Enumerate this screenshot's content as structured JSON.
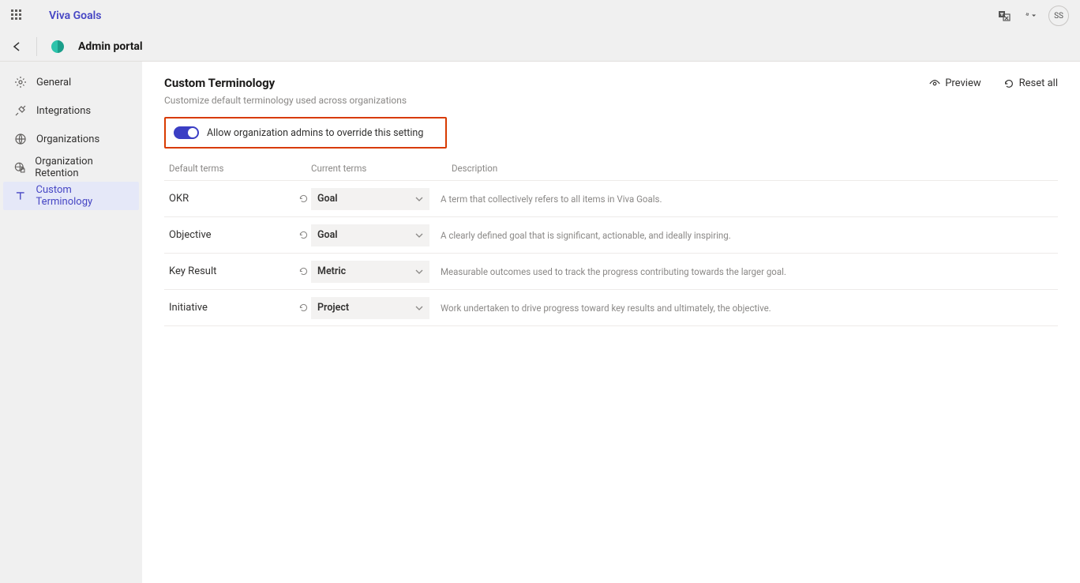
{
  "header": {
    "app_name": "Viva Goals",
    "avatar_initials": "SS"
  },
  "subheader": {
    "title": "Admin portal"
  },
  "sidebar": {
    "items": [
      {
        "label": "General"
      },
      {
        "label": "Integrations"
      },
      {
        "label": "Organizations"
      },
      {
        "label": "Organization Retention"
      },
      {
        "label": "Custom Terminology"
      }
    ]
  },
  "page": {
    "title": "Custom Terminology",
    "subtitle": "Customize default terminology used across organizations",
    "preview_label": "Preview",
    "reset_label": "Reset all",
    "toggle_label": "Allow organization admins to override this setting"
  },
  "columns": {
    "default": "Default terms",
    "current": "Current terms",
    "description": "Description"
  },
  "rows": [
    {
      "default": "OKR",
      "current": "Goal",
      "description": "A term that collectively refers to all items in Viva Goals."
    },
    {
      "default": "Objective",
      "current": "Goal",
      "description": "A clearly defined goal that is significant, actionable, and ideally inspiring."
    },
    {
      "default": "Key Result",
      "current": "Metric",
      "description": "Measurable outcomes used to track the progress contributing towards the larger goal."
    },
    {
      "default": "Initiative",
      "current": "Project",
      "description": "Work undertaken to drive progress toward key results and ultimately, the objective."
    }
  ]
}
